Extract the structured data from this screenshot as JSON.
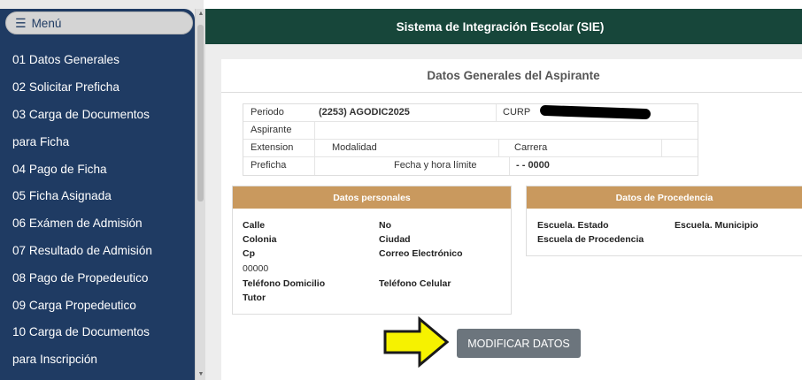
{
  "app": {
    "title": "Sistema de Integración Escolar (SIE)"
  },
  "sidebar": {
    "menu_label": "Menú",
    "items": [
      {
        "label": "01 Datos Generales"
      },
      {
        "label": "02 Solicitar Preficha"
      },
      {
        "label": "03 Carga de Documentos"
      },
      {
        "label": "para Ficha"
      },
      {
        "label": "04 Pago de Ficha"
      },
      {
        "label": "05 Ficha Asignada"
      },
      {
        "label": "06 Exámen de Admisión"
      },
      {
        "label": "07 Resultado de Admisión"
      },
      {
        "label": "08 Pago de Propedeutico"
      },
      {
        "label": "09 Carga Propedeutico"
      },
      {
        "label": "10 Carga de Documentos"
      },
      {
        "label": "para Inscripción"
      }
    ]
  },
  "main": {
    "card_title": "Datos Generales del Aspirante",
    "info": {
      "periodo_label": "Periodo",
      "periodo_value": "(2253) AGODIC2025",
      "curp_label": "CURP",
      "aspirante_label": "Aspirante",
      "extension_label": "Extension",
      "modalidad_label": "Modalidad",
      "carrera_label": "Carrera",
      "preficha_label": "Preficha",
      "fecha_label": "Fecha y hora límite",
      "fecha_value": "- - 0000"
    },
    "personal": {
      "title": "Datos personales",
      "calle": "Calle",
      "no": "No",
      "colonia": "Colonia",
      "ciudad": "Ciudad",
      "cp": "Cp",
      "correo": "Correo Electrónico",
      "cp_value": "00000",
      "tel_dom": "Teléfono Domicilio",
      "tel_cel": "Teléfono Celular",
      "tutor": "Tutor"
    },
    "procedencia": {
      "title": "Datos de Procedencia",
      "escuela_estado": "Escuela. Estado",
      "escuela_municipio": "Escuela. Municipio",
      "escuela_procedencia": "Escuela de Procedencia"
    },
    "modify_button": "MODIFICAR DATOS"
  },
  "colors": {
    "sidebar_bg": "#1f3b63",
    "topbar_bg": "#17463a",
    "panel_header": "#c9995e",
    "button_bg": "#6c757d",
    "arrow_fill": "#f6f200"
  }
}
